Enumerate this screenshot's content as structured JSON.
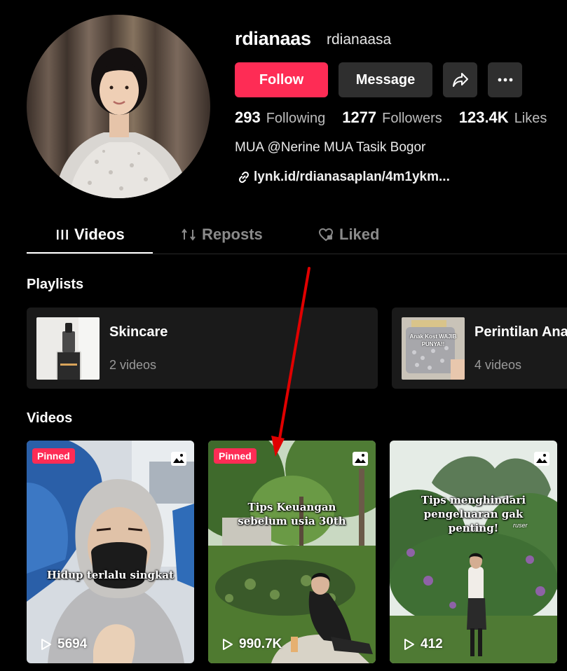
{
  "profile": {
    "username": "rdianaas",
    "nickname": "rdianaasa",
    "follow_label": "Follow",
    "message_label": "Message",
    "bio": "MUA @Nerine MUA Tasik Bogor",
    "link": "lynk.id/rdianasaplan/4m1ykm..."
  },
  "stats": [
    {
      "value": "293",
      "label": "Following"
    },
    {
      "value": "1277",
      "label": "Followers"
    },
    {
      "value": "123.4K",
      "label": "Likes"
    }
  ],
  "tabs": [
    {
      "label": "Videos",
      "icon": "grid-icon",
      "active": true
    },
    {
      "label": "Reposts",
      "icon": "repost-icon",
      "active": false
    },
    {
      "label": "Liked",
      "icon": "heart-lock-icon",
      "active": false
    }
  ],
  "sections": {
    "playlists_title": "Playlists",
    "videos_title": "Videos"
  },
  "playlists": [
    {
      "name": "Skincare",
      "count": "2 videos"
    },
    {
      "name": "Perintilan Ana",
      "count": "4 videos",
      "thumb_text": "Anak Kost WAJIB PUNYA!!"
    }
  ],
  "videos": [
    {
      "pinned_label": "Pinned",
      "caption": "Hidup terlalu singkat",
      "views": "5694"
    },
    {
      "pinned_label": "Pinned",
      "caption": "Tips Keuangan sebelum usia 30th",
      "views": "990.7K"
    },
    {
      "pinned_label": "",
      "caption": "Tips menghindari pengeluaran gak penting!",
      "views": "412",
      "watermark": "ruser"
    }
  ],
  "colors": {
    "accent": "#fe2c55",
    "button_dark": "#2f2f2f",
    "annotation_arrow": "#e00000"
  }
}
